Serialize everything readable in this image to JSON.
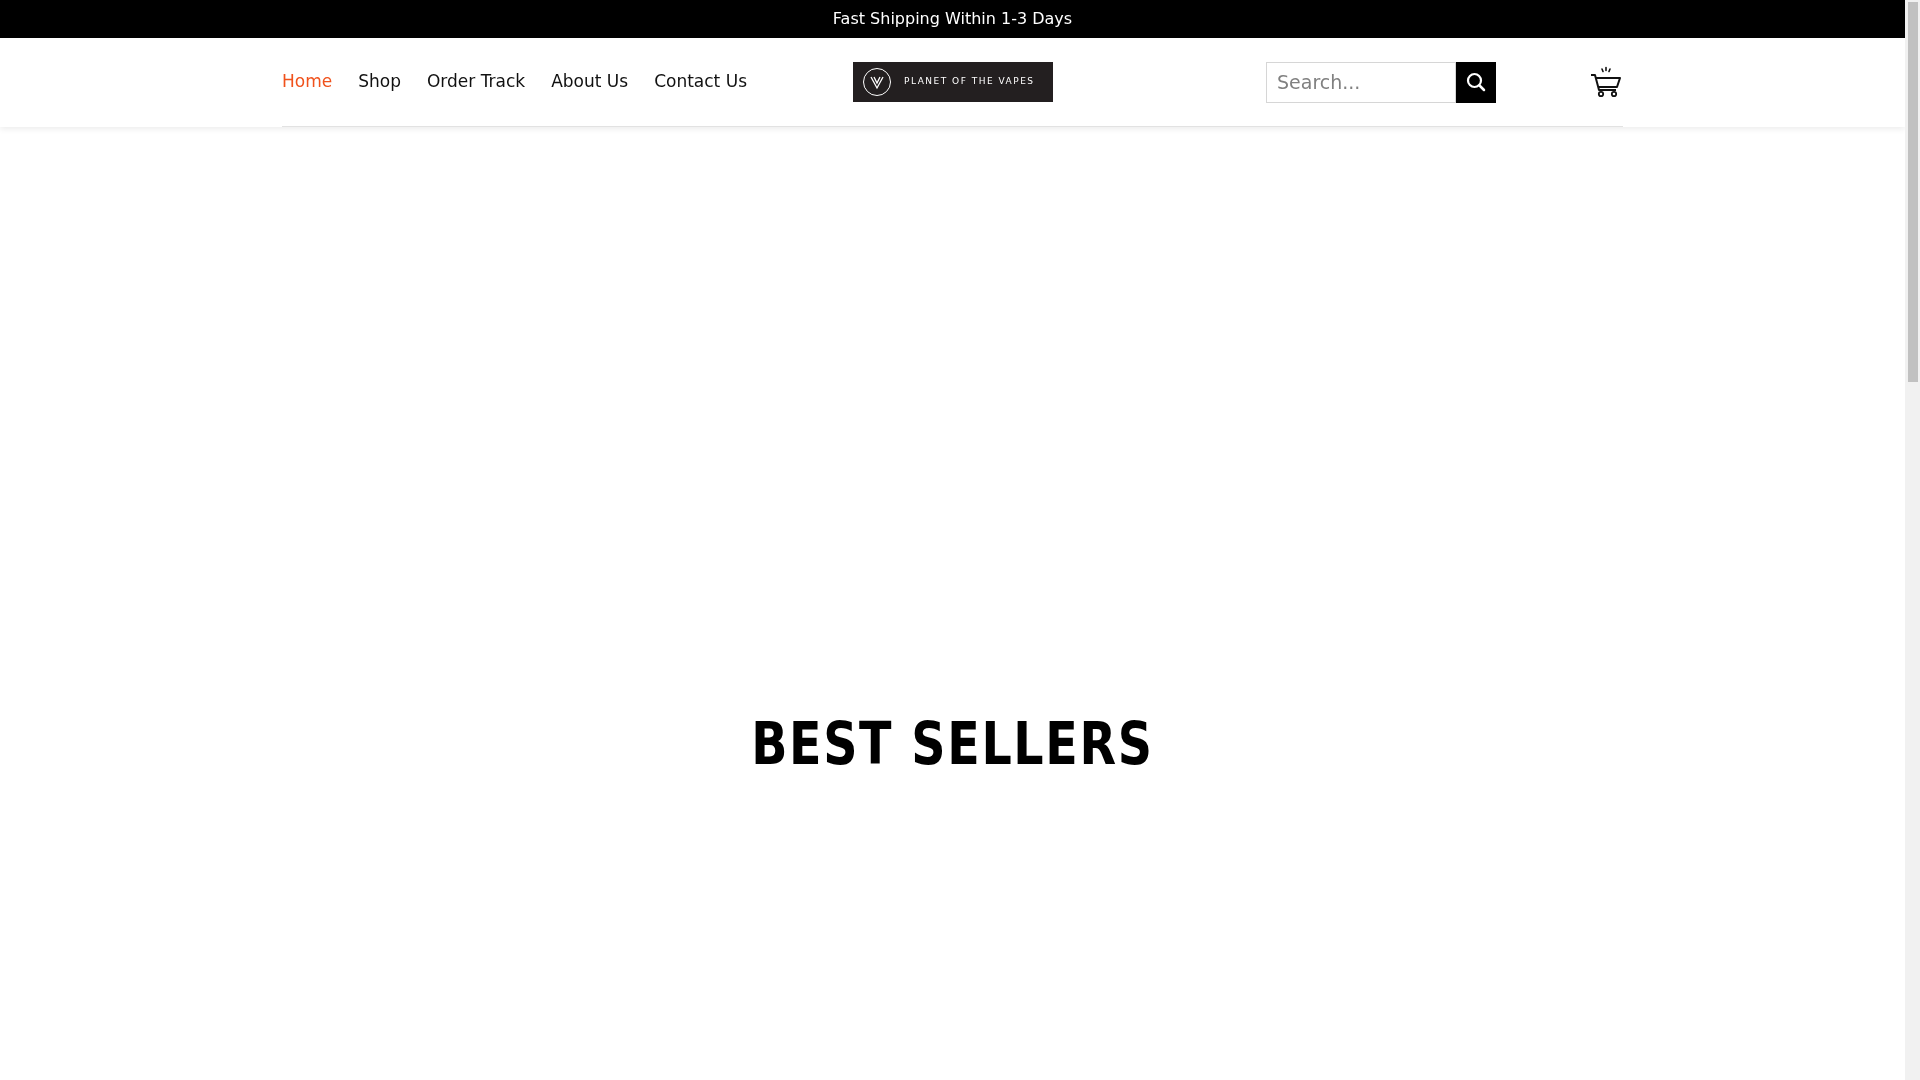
{
  "announcement": "Fast Shipping Within 1-3 Days",
  "nav": [
    {
      "label": "Home",
      "selected": true
    },
    {
      "label": "Shop",
      "selected": false
    },
    {
      "label": "Order Track",
      "selected": false
    },
    {
      "label": "About Us",
      "selected": false
    },
    {
      "label": "Contact Us",
      "selected": false
    }
  ],
  "logo": {
    "text": "PLANET OF THE VAPES"
  },
  "search": {
    "placeholder": "Search..."
  },
  "section_title": "BEST SELLERS"
}
